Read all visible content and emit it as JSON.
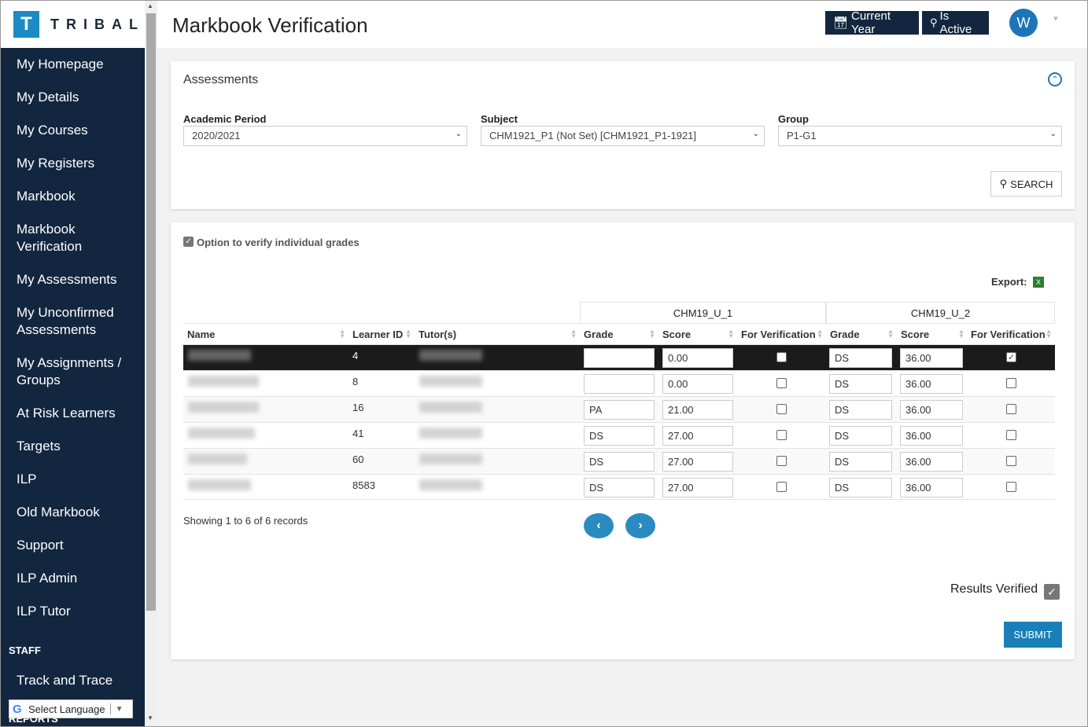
{
  "logo": {
    "mark": "T",
    "text": "TRIBAL"
  },
  "sidebar": {
    "items": [
      {
        "label": "My Homepage"
      },
      {
        "label": "My Details"
      },
      {
        "label": "My Courses"
      },
      {
        "label": "My Registers"
      },
      {
        "label": "Markbook"
      },
      {
        "label": "Markbook Verification"
      },
      {
        "label": "My Assessments"
      },
      {
        "label": "My Unconfirmed Assessments"
      },
      {
        "label": "My Assignments / Groups"
      },
      {
        "label": "At Risk Learners"
      },
      {
        "label": "Targets"
      },
      {
        "label": "ILP"
      },
      {
        "label": "Old Markbook"
      },
      {
        "label": "Support"
      },
      {
        "label": "ILP Admin"
      },
      {
        "label": "ILP Tutor"
      }
    ],
    "staff_label": "STAFF",
    "staff_items": [
      {
        "label": "Track and Trace"
      }
    ],
    "reports_label": "REPORTS",
    "language": {
      "label": "Select Language"
    }
  },
  "header": {
    "title": "Markbook Verification",
    "current_year": "Current Year",
    "is_active": "Is Active",
    "avatar": "W"
  },
  "assessments": {
    "title": "Assessments",
    "academic_period": {
      "label": "Academic Period",
      "value": "2020/2021"
    },
    "subject": {
      "label": "Subject",
      "value": "CHM1921_P1 (Not Set) [CHM1921_P1-1921]"
    },
    "group": {
      "label": "Group",
      "value": "P1-G1"
    },
    "search": "SEARCH"
  },
  "results": {
    "option_label": "Option to verify individual grades",
    "export_label": "Export:",
    "groups": [
      "CHM19_U_1",
      "CHM19_U_2"
    ],
    "columns": {
      "name": "Name",
      "learner_id": "Learner ID",
      "tutors": "Tutor(s)",
      "grade": "Grade",
      "score": "Score",
      "for_verification": "For Verification"
    },
    "rows": [
      {
        "learner_id": "4",
        "u1_grade": "",
        "u1_score": "0.00",
        "u1_verify": false,
        "u2_grade": "DS",
        "u2_score": "36.00",
        "u2_verify": true
      },
      {
        "learner_id": "8",
        "u1_grade": "",
        "u1_score": "0.00",
        "u1_verify": false,
        "u2_grade": "DS",
        "u2_score": "36.00",
        "u2_verify": false
      },
      {
        "learner_id": "16",
        "u1_grade": "PA",
        "u1_score": "21.00",
        "u1_verify": false,
        "u2_grade": "DS",
        "u2_score": "36.00",
        "u2_verify": false
      },
      {
        "learner_id": "41",
        "u1_grade": "DS",
        "u1_score": "27.00",
        "u1_verify": false,
        "u2_grade": "DS",
        "u2_score": "36.00",
        "u2_verify": false
      },
      {
        "learner_id": "60",
        "u1_grade": "DS",
        "u1_score": "27.00",
        "u1_verify": false,
        "u2_grade": "DS",
        "u2_score": "36.00",
        "u2_verify": false
      },
      {
        "learner_id": "8583",
        "u1_grade": "DS",
        "u1_score": "27.00",
        "u1_verify": false,
        "u2_grade": "DS",
        "u2_score": "36.00",
        "u2_verify": false
      }
    ],
    "showing": "Showing 1 to 6 of 6 records",
    "results_verified": "Results Verified",
    "submit": "SUBMIT"
  }
}
